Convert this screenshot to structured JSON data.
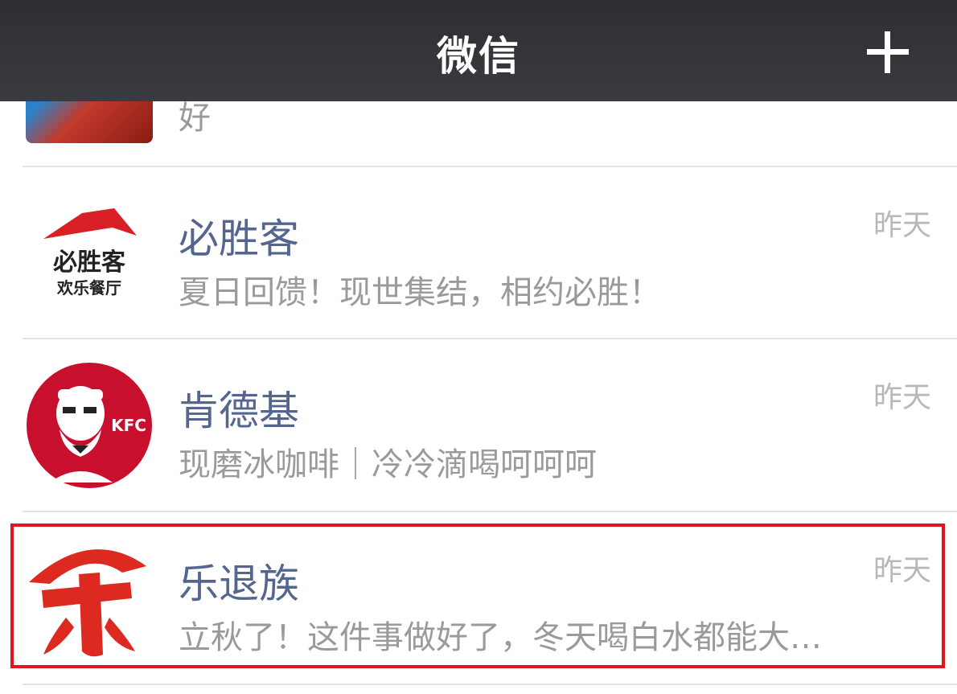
{
  "nav": {
    "title": "微信",
    "plus_icon": "plus-icon"
  },
  "rows": [
    {
      "name": "",
      "preview": "好",
      "time": ""
    },
    {
      "name": "必胜客",
      "preview": "夏日回馈！现世集结，相约必胜！",
      "time": "昨天",
      "avatar_text": "必胜客",
      "avatar_subtext": "欢乐餐厅"
    },
    {
      "name": "肯德基",
      "preview": "现磨冰咖啡｜冷冷滴喝呵呵呵",
      "time": "昨天",
      "avatar_text": "KFC"
    },
    {
      "name": "乐退族",
      "preview": "立秋了！这件事做好了，冬天喝白水都能大…",
      "time": "昨天"
    }
  ],
  "colors": {
    "accent": "#e0151f",
    "name": "#54668f",
    "nav": "#35363a"
  }
}
